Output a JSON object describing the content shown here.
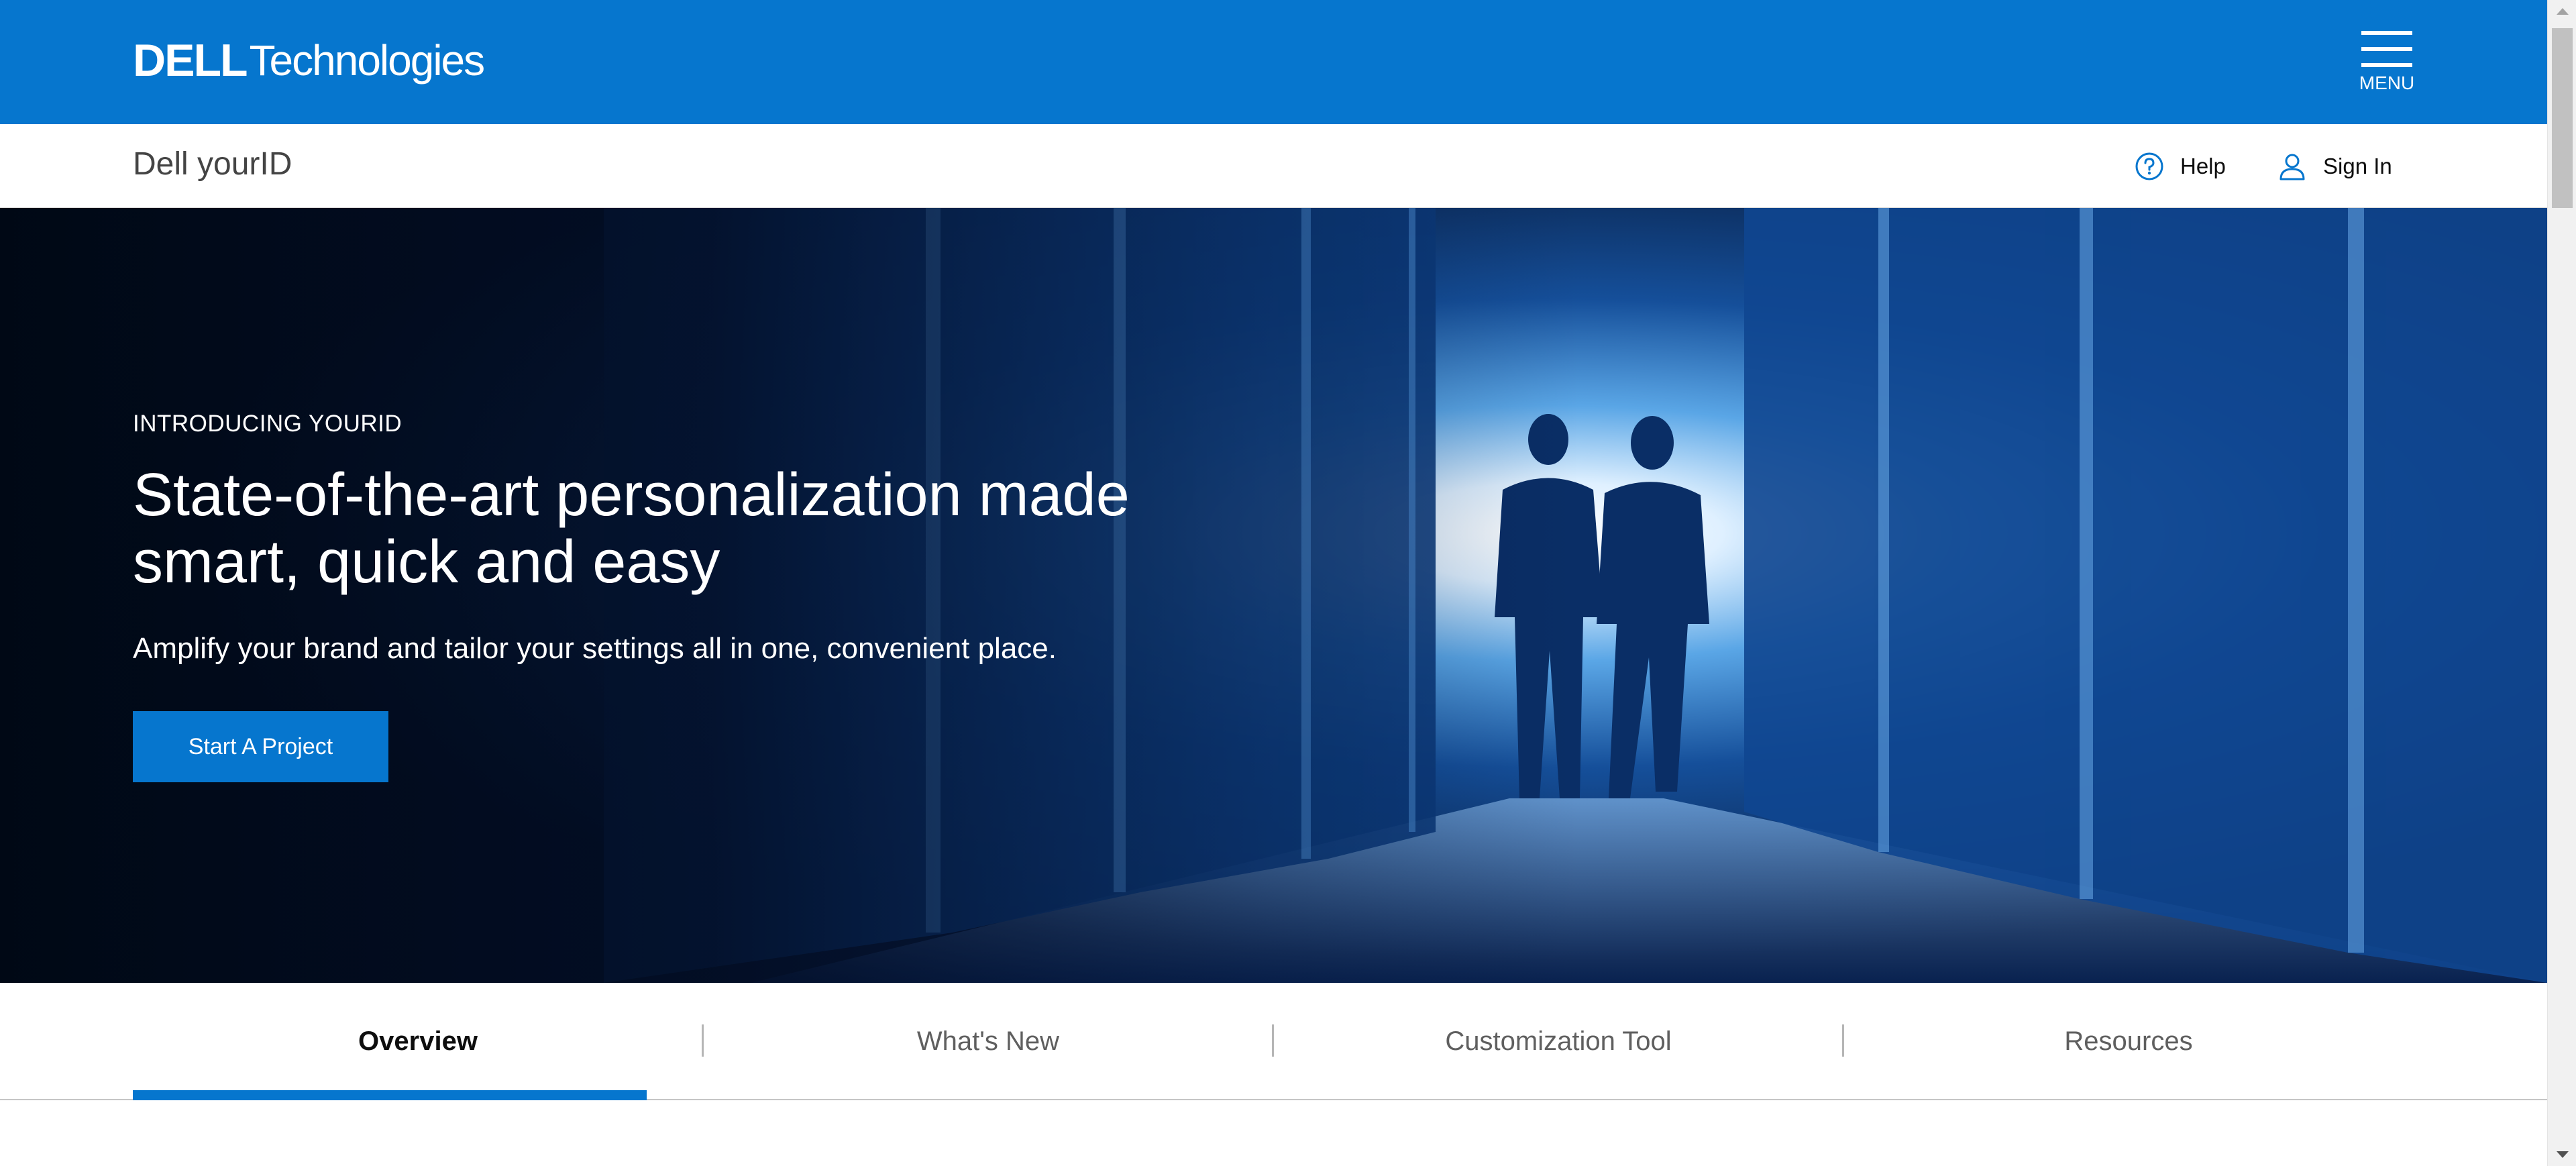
{
  "header": {
    "logo_dell": "DELL",
    "logo_technologies": "Technologies",
    "menu_label": "MENU"
  },
  "subheader": {
    "product_name": "Dell yourID",
    "help_label": "Help",
    "signin_label": "Sign In"
  },
  "hero": {
    "eyebrow": "INTRODUCING YOURID",
    "headline_line1": "State-of-the-art personalization made",
    "headline_line2": "smart, quick and easy",
    "subtext": "Amplify your brand and tailor your settings all in one, convenient place.",
    "cta_label": "Start A Project"
  },
  "tabs": {
    "items": [
      {
        "label": "Overview",
        "active": true
      },
      {
        "label": "What's New",
        "active": false
      },
      {
        "label": "Customization Tool",
        "active": false
      },
      {
        "label": "Resources",
        "active": false
      }
    ]
  },
  "colors": {
    "brand_blue": "#0676ce",
    "tab_text": "#5f5f5f",
    "active_tab_text": "#0e0e0e"
  }
}
